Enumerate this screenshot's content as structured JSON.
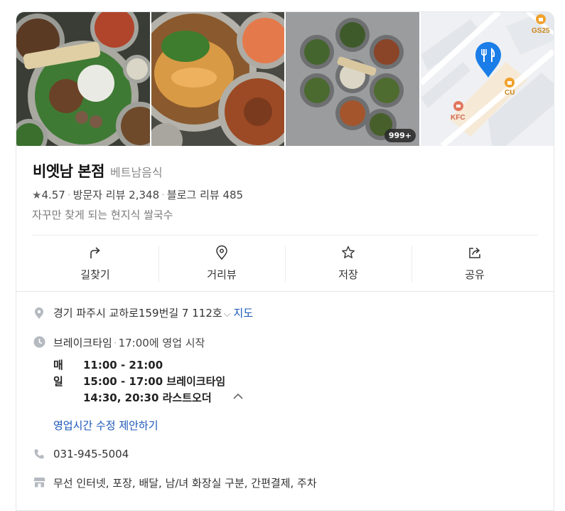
{
  "gallery": {
    "photos": [
      "bowl-spread-photo",
      "fried-dish-photo",
      "overhead-bowls-photo"
    ],
    "photo_count_badge": "999+",
    "map": {
      "labels": {
        "gs25": "GS25",
        "cu": "CU",
        "kfc": "KFC"
      },
      "pin_icon": "restaurant-pin-icon"
    }
  },
  "place": {
    "name": "비엣남 본점",
    "category": "베트남음식",
    "rating": "4.57",
    "visitor_reviews": "방문자 리뷰 2,348",
    "blog_reviews": "블로그 리뷰 485",
    "description": "자꾸만 찾게 되는 현지식 쌀국수"
  },
  "actions": [
    {
      "label": "길찾기",
      "icon": "directions-icon"
    },
    {
      "label": "거리뷰",
      "icon": "location-pin-icon"
    },
    {
      "label": "저장",
      "icon": "star-outline-icon"
    },
    {
      "label": "공유",
      "icon": "share-icon"
    }
  ],
  "info": {
    "address": "경기 파주시 교하로159번길 7 112호",
    "map_link": "지도",
    "status": "브레이크타임",
    "status_detail": "17:00에 영업 시작",
    "hours_day": "매일",
    "hours_lines": [
      "11:00 - 21:00",
      "15:00 - 17:00 브레이크타임",
      "14:30, 20:30 라스트오더"
    ],
    "suggest_edit": "영업시간 수정 제안하기",
    "phone": "031-945-5004",
    "amenities": "무선 인터넷, 포장, 배달, 남/녀 화장실 구분, 간편결제, 주차"
  },
  "colors": {
    "accent_link": "#1a56b8",
    "map_pin": "#1a7de8",
    "map_label": "#c9861c"
  }
}
